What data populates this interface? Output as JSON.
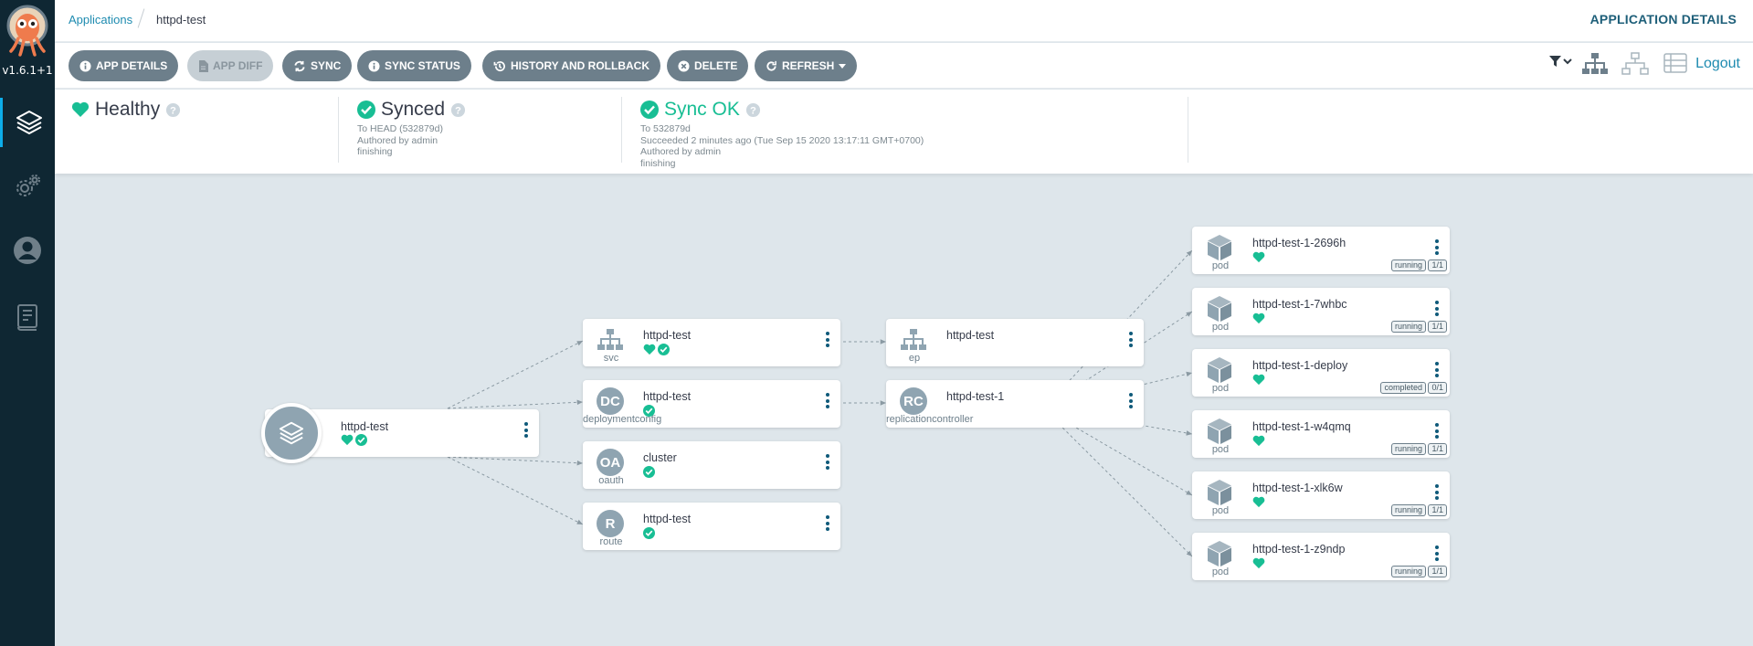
{
  "sidebar": {
    "version": "v1.6.1+1",
    "items": [
      {
        "name": "applications",
        "icon": "layers-icon"
      },
      {
        "name": "settings",
        "icon": "gear-icon"
      },
      {
        "name": "user-info",
        "icon": "user-icon"
      },
      {
        "name": "docs",
        "icon": "book-icon"
      }
    ]
  },
  "header": {
    "breadcrumb_root": "Applications",
    "breadcrumb_current": "httpd-test",
    "page_title": "APPLICATION DETAILS"
  },
  "toolbar": {
    "app_details": "APP DETAILS",
    "app_diff": "APP DIFF",
    "sync": "SYNC",
    "sync_status": "SYNC STATUS",
    "history": "HISTORY AND ROLLBACK",
    "delete": "DELETE",
    "refresh": "REFRESH",
    "logout": "Logout"
  },
  "status": {
    "health": {
      "label": "Healthy"
    },
    "sync": {
      "label": "Synced",
      "line1": "To HEAD (532879d)",
      "line2": "Authored by admin",
      "line3": "finishing"
    },
    "operation": {
      "label": "Sync OK",
      "line1": "To 532879d",
      "line2": "Succeeded 2 minutes ago (Tue Sep 15 2020 13:17:11 GMT+0700)",
      "line3": "Authored by admin",
      "line4": "finishing"
    }
  },
  "graph": {
    "app": {
      "name": "httpd-test"
    },
    "level1": [
      {
        "name": "httpd-test",
        "kind": "svc",
        "icon": "network-icon",
        "health": true,
        "synced": true
      },
      {
        "name": "httpd-test",
        "kind": "deploymentconfig",
        "abbr": "DC",
        "health": false,
        "synced": true
      },
      {
        "name": "cluster",
        "kind": "oauth",
        "abbr": "OA",
        "health": false,
        "synced": true
      },
      {
        "name": "httpd-test",
        "kind": "route",
        "abbr": "R",
        "health": false,
        "synced": true
      }
    ],
    "level2": [
      {
        "name": "httpd-test",
        "kind": "ep",
        "icon": "network-icon"
      },
      {
        "name": "httpd-test-1",
        "kind": "replicationcontroller",
        "abbr": "RC"
      }
    ],
    "pods": [
      {
        "name": "httpd-test-1-2696h",
        "kind": "pod",
        "state": "running",
        "ready": "1/1"
      },
      {
        "name": "httpd-test-1-7whbc",
        "kind": "pod",
        "state": "running",
        "ready": "1/1"
      },
      {
        "name": "httpd-test-1-deploy",
        "kind": "pod",
        "state": "completed",
        "ready": "0/1"
      },
      {
        "name": "httpd-test-1-w4qmq",
        "kind": "pod",
        "state": "running",
        "ready": "1/1"
      },
      {
        "name": "httpd-test-1-xlk6w",
        "kind": "pod",
        "state": "running",
        "ready": "1/1"
      },
      {
        "name": "httpd-test-1-z9ndp",
        "kind": "pod",
        "state": "running",
        "ready": "1/1"
      }
    ]
  },
  "colors": {
    "accent": "#1e8bb0",
    "healthy": "#18be94",
    "sidebar": "#0f2733",
    "button": "#6d7f8b"
  }
}
